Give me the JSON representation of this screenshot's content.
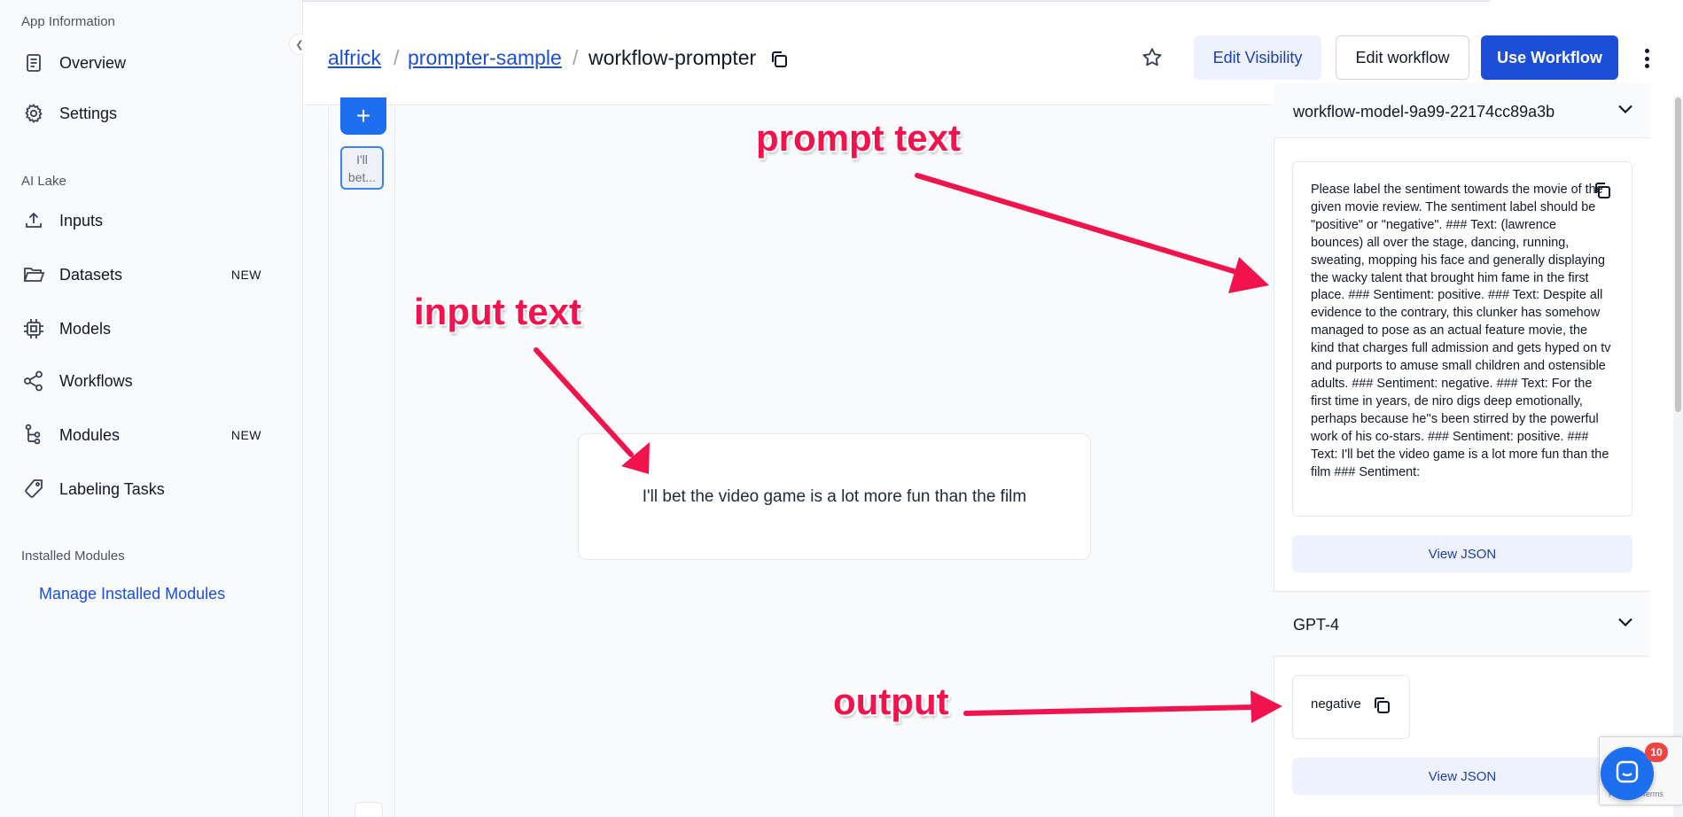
{
  "sidebar": {
    "section_app": "App Information",
    "section_ai": "AI Lake",
    "section_installed": "Installed Modules",
    "items": [
      {
        "label": "Overview",
        "icon": "document-icon"
      },
      {
        "label": "Settings",
        "icon": "gear-icon"
      },
      {
        "label": "Inputs",
        "icon": "upload-icon"
      },
      {
        "label": "Datasets",
        "icon": "folder-icon",
        "badge": "NEW"
      },
      {
        "label": "Models",
        "icon": "chip-icon"
      },
      {
        "label": "Workflows",
        "icon": "share-icon"
      },
      {
        "label": "Modules",
        "icon": "modules-icon",
        "badge": "NEW"
      },
      {
        "label": "Labeling Tasks",
        "icon": "tag-icon"
      }
    ],
    "manage_link": "Manage Installed Modules",
    "collapse_icon": "chevron-left-icon"
  },
  "header": {
    "crumbs": [
      "alfrick",
      "prompter-sample",
      "workflow-prompter"
    ],
    "sep": "/",
    "edit_visibility": "Edit Visibility",
    "edit_workflow": "Edit workflow",
    "use_workflow": "Use Workflow",
    "star_icon": "star-icon",
    "menu_icon": "kebab-menu-icon"
  },
  "thumbs": {
    "add": "+",
    "item": "I'll bet..."
  },
  "input_text": "I'll bet the video game is a lot more fun than the film",
  "panel": {
    "model_header": "workflow-model-9a99-22174cc89a3b",
    "prompt": "Please label the sentiment towards the movie of the given movie review. The sentiment label should be \"positive\" or \"negative\". ### Text: (lawrence bounces) all over the stage, dancing, running, sweating, mopping his face and generally displaying the wacky talent that brought him fame in the first place. ### Sentiment: positive. ### Text: Despite all evidence to the contrary, this clunker has somehow managed to pose as an actual feature movie, the kind that charges full admission and gets hyped on tv and purports to amuse small children and ostensible adults. ### Sentiment: negative. ### Text: For the first time in years, de niro digs deep emotionally, perhaps because he''s been stirred by the powerful work of his co-stars. ### Sentiment: positive. ### Text: I'll bet the video game is a lot more fun than the film ### Sentiment:",
    "view_json": "View JSON",
    "gpt_header": "GPT-4",
    "output": "negative"
  },
  "chat": {
    "badge": "10",
    "recaptcha": "Privacy - Terms"
  },
  "annotations": {
    "prompt": "prompt text",
    "input": "input text",
    "output": "output",
    "color": "#f0134d"
  },
  "colors": {
    "accent": "#1d4ed8",
    "primary_button": "#1d4ed8",
    "badge_red": "#ef4444"
  }
}
